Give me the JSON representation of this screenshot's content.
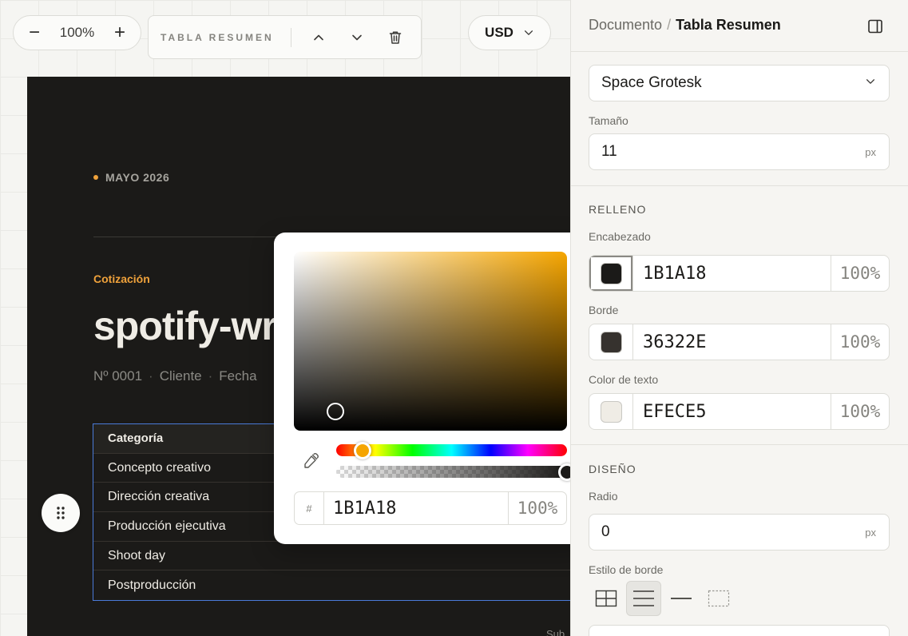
{
  "toolbar": {
    "zoom_out_glyph": "−",
    "zoom_level": "100%",
    "zoom_in_glyph": "+",
    "selection_label": "TABLA RESUMEN",
    "move_up_icon": "chevron-up-icon",
    "move_down_icon": "chevron-down-icon",
    "delete_icon": "trash-icon",
    "currency": "USD"
  },
  "canvas": {
    "date": "MAYO 2026",
    "kicker": "Cotización",
    "title": "spotify-wr",
    "meta": [
      "Nº 0001",
      "Cliente",
      "Fecha"
    ],
    "table": {
      "header": "Categoría",
      "rows": [
        "Concepto creativo",
        "Dirección creativa",
        "Producción ejecutiva",
        "Shoot day",
        "Postproducción"
      ]
    },
    "footer_fragment": "Sub",
    "accent_color": "#f0a23b",
    "background_color": "#1b1a18"
  },
  "color_picker": {
    "hash": "#",
    "hex": "1B1A18",
    "opacity": "100%",
    "hue_fraction": 0.115,
    "alpha_fraction": 1.0,
    "eyedropper_icon": "eyedropper-icon"
  },
  "panel": {
    "breadcrumb": {
      "parent": "Documento",
      "separator": "/",
      "current": "Tabla Resumen"
    },
    "toggle_icon": "panel-toggle-icon",
    "font_family_value": "Space Grotesk",
    "size_label": "Tamaño",
    "size_value": "11",
    "size_unit": "px",
    "fill_section": "RELLENO",
    "header_fill": {
      "label": "Encabezado",
      "hex": "1B1A18",
      "opacity": "100%",
      "color": "#1b1a18"
    },
    "border_fill": {
      "label": "Borde",
      "hex": "36322E",
      "opacity": "100%",
      "color": "#36322e"
    },
    "text_fill": {
      "label": "Color de texto",
      "hex": "EFECE5",
      "opacity": "100%",
      "color": "#efece5"
    },
    "design_section": "DISEÑO",
    "radius_label": "Radio",
    "radius_value": "0",
    "radius_unit": "px",
    "border_style_label": "Estilo de borde",
    "border_styles": [
      "grid-border-icon",
      "horizontal-lines-icon",
      "single-line-icon",
      "dashed-border-icon"
    ],
    "border_style_selected": 1
  }
}
